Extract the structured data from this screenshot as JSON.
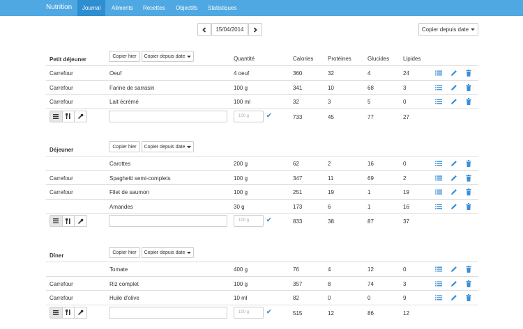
{
  "nav": {
    "brand": "Nutrition",
    "items": [
      {
        "label": "Journal",
        "active": true
      },
      {
        "label": "Aliments"
      },
      {
        "label": "Recettes"
      },
      {
        "label": "Objectifs"
      },
      {
        "label": "Statistiques"
      }
    ],
    "bg": "#4fa8e2",
    "active_bg": "#2f8ed0"
  },
  "datebar": {
    "date": "15/04/2014",
    "copy_label": "Copier depuis date"
  },
  "columns": {
    "quantity": "Quantité",
    "calories": "Calories",
    "proteins": "Protéines",
    "carbs": "Glucides",
    "fats": "Lipides"
  },
  "meal_buttons": {
    "copy_yesterday": "Copier hier",
    "copy_from_date": "Copier depuis date"
  },
  "qty_placeholder": "100 g",
  "meals": [
    {
      "name": "Petit déjeuner",
      "rows": [
        {
          "brand": "Carrefour",
          "food": "Oeuf",
          "qty": "4 oeuf",
          "cal": "360",
          "prot": "32",
          "carb": "4",
          "fat": "24"
        },
        {
          "brand": "Carrefour",
          "food": "Farine de sarrasin",
          "qty": "100 g",
          "cal": "341",
          "prot": "10",
          "carb": "68",
          "fat": "3"
        },
        {
          "brand": "Carrefour",
          "food": "Lait écrémé",
          "qty": "100 ml",
          "cal": "32",
          "prot": "3",
          "carb": "5",
          "fat": "0"
        }
      ],
      "totals": {
        "cal": "733",
        "prot": "45",
        "carb": "77",
        "fat": "27"
      }
    },
    {
      "name": "Déjeuner",
      "rows": [
        {
          "brand": "",
          "food": "Carottes",
          "qty": "200 g",
          "cal": "62",
          "prot": "2",
          "carb": "16",
          "fat": "0"
        },
        {
          "brand": "Carrefour",
          "food": "Spaghetti semi-complets",
          "qty": "100 g",
          "cal": "347",
          "prot": "11",
          "carb": "69",
          "fat": "2"
        },
        {
          "brand": "Carrefour",
          "food": "Filet de saumon",
          "qty": "100 g",
          "cal": "251",
          "prot": "19",
          "carb": "1",
          "fat": "19"
        },
        {
          "brand": "",
          "food": "Amandes",
          "qty": "30 g",
          "cal": "173",
          "prot": "6",
          "carb": "1",
          "fat": "16"
        }
      ],
      "totals": {
        "cal": "833",
        "prot": "38",
        "carb": "87",
        "fat": "37"
      }
    },
    {
      "name": "Dîner",
      "rows": [
        {
          "brand": "",
          "food": "Tomate",
          "qty": "400 g",
          "cal": "76",
          "prot": "4",
          "carb": "12",
          "fat": "0"
        },
        {
          "brand": "Carrefour",
          "food": "Riz complet",
          "qty": "100 g",
          "cal": "357",
          "prot": "8",
          "carb": "74",
          "fat": "3"
        },
        {
          "brand": "Carrefour",
          "food": "Huile d'olive",
          "qty": "10 ml",
          "cal": "82",
          "prot": "0",
          "carb": "0",
          "fat": "9"
        }
      ],
      "totals": {
        "cal": "515",
        "prot": "12",
        "carb": "86",
        "fat": "12"
      }
    }
  ],
  "icon_color": "#3a8fd6"
}
